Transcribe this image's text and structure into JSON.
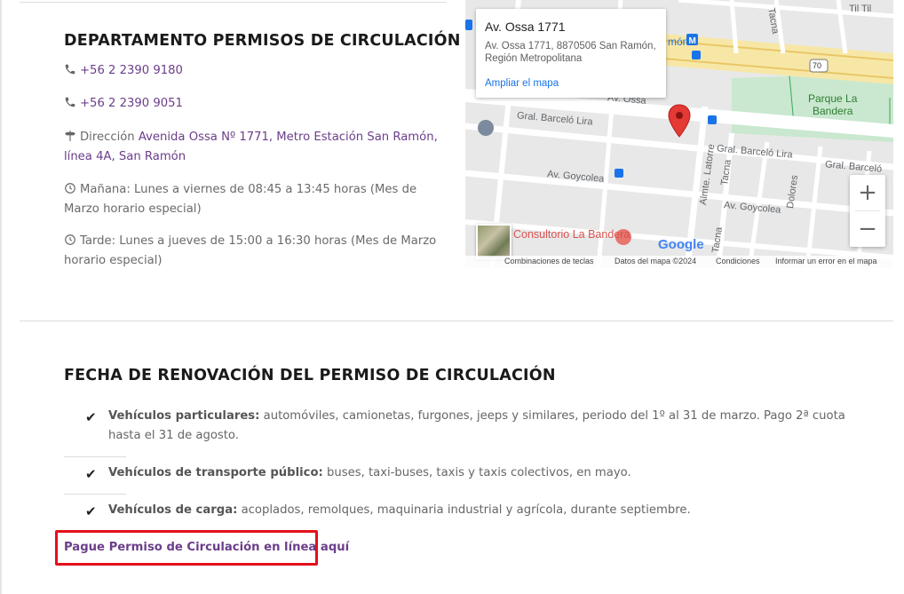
{
  "contact_section": {
    "title": "DEPARTAMENTO PERMISOS DE CIRCULACIÓN",
    "phone1": "+56 2 2390 9180",
    "phone2": "+56 2 2390 9051",
    "address_prefix": "Dirección",
    "address_link": "Avenida Ossa Nº 1771, Metro Estación San Ramón, línea 4A, San Ramón",
    "hours_morning": "Mañana: Lunes a viernes de 08:45 a 13:45 horas (Mes de Marzo horario especial)",
    "hours_afternoon": "Tarde: Lunes a jueves de 15:00 a 16:30 horas (Mes de Marzo horario especial)"
  },
  "map": {
    "card_title": "Av. Ossa 1771",
    "card_address": "Av. Ossa 1771, 8870506 San Ramón, Región Metropolitana",
    "card_link": "Ampliar el mapa",
    "zoom_in": "+",
    "zoom_out": "−",
    "labels": {
      "til_til": "Til Til",
      "tacna_top": "Tacna",
      "ramon": "món",
      "route": "70",
      "parque_line1": "Parque La",
      "parque_line2": "Bandera",
      "ossa": "Av. Ossa",
      "gral_barcelo_1": "Gral. Barceló Lira",
      "gral_barcelo_2": "Gral. Barceló Lira",
      "gral_barcelo_3": "Gral. Barceló",
      "av_goycolea_1": "Av. Goycolea",
      "av_goycolea_2": "Av. Goycolea",
      "almte_latorre": "Almte. Latorre",
      "tacna_mid": "Tacna",
      "tacna_low": "Tacna",
      "dolores": "Dolores",
      "consultorio": "Consultorio La Bandera",
      "google": "Google"
    },
    "footer": {
      "shortcuts": "Combinaciones de teclas",
      "map_data": "Datos del mapa ©2024",
      "terms": "Condiciones",
      "report": "Informar un error en el mapa"
    }
  },
  "renewal_section": {
    "title": "FECHA DE RENOVACIÓN DEL PERMISO DE CIRCULACIÓN",
    "items": [
      {
        "bold": "Vehículos particulares:",
        "text": " automóviles, camionetas, furgones, jeeps y similares, periodo del 1º al 31 de marzo. Pago 2ª cuota hasta el 31 de agosto."
      },
      {
        "bold": "Vehículos de transporte público:",
        "text": " buses, taxi-buses, taxis y taxis colectivos, en mayo."
      },
      {
        "bold": "Vehículos de carga:",
        "text": " acoplados, remolques, maquinaria industrial y agrícola, durante septiembre."
      }
    ],
    "check_symbol": "✔",
    "pay_link": "Pague Permiso de Circulación en línea aquí"
  },
  "colors": {
    "link_purple": "#6b3e8a",
    "highlight_red": "#e3101a",
    "map_pin_red": "#e53935"
  }
}
